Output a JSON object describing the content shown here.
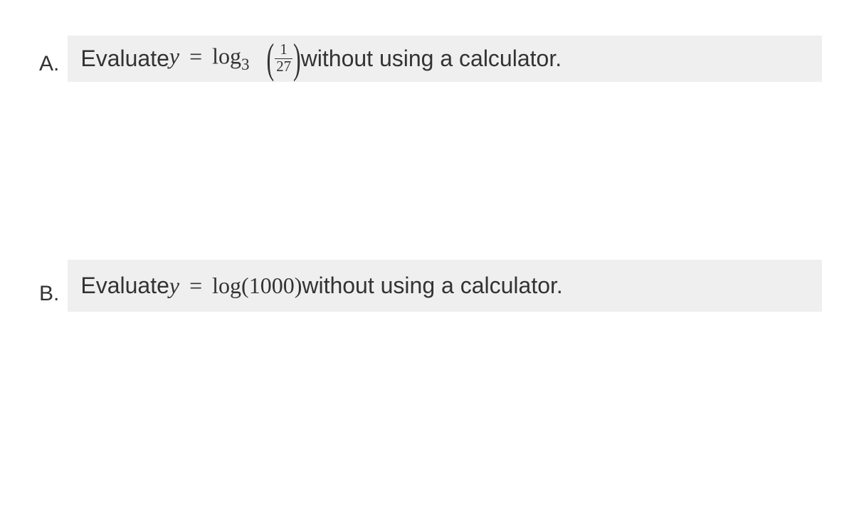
{
  "problems": {
    "a": {
      "label": "A.",
      "text_prefix": "Evaluate ",
      "var": "y",
      "equals": "=",
      "log_text": "log",
      "log_base": "3",
      "paren_open": "(",
      "frac_num": "1",
      "frac_den": "27",
      "paren_close": ")",
      "text_suffix": " without using a calculator."
    },
    "b": {
      "label": "B.",
      "text_prefix": "Evaluate ",
      "var": "y",
      "equals": "=",
      "log_text": "log",
      "arg_open": "(",
      "arg_value": "1000",
      "arg_close": ")",
      "text_suffix": " without using a calculator."
    }
  }
}
